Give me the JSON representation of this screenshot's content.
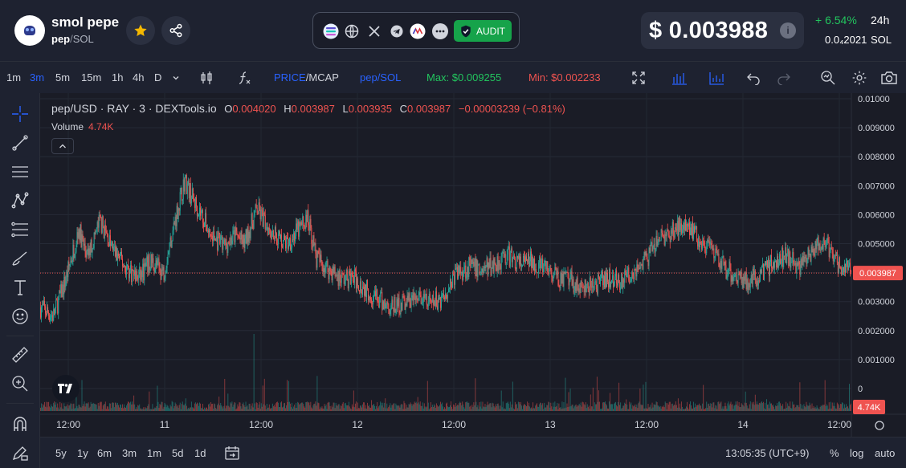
{
  "header": {
    "token_name": "smol pepe",
    "token_symbol": "pep",
    "separator": "/",
    "quote_symbol": "SOL",
    "audit_label": "AUDIT",
    "price": "$ 0.003988",
    "info_symbol": "i",
    "change": "+ 6.54%",
    "period": "24h",
    "sol_price": "0.0₄2021",
    "sol_unit": "SOL",
    "colors": {
      "positive": "#22c55e",
      "negative": "#ef5350",
      "accent": "#2962ff",
      "audit": "#16a34a"
    }
  },
  "toolbar": {
    "timeframes": [
      "1m",
      "3m",
      "5m",
      "15m",
      "1h",
      "4h",
      "D"
    ],
    "active_timeframe": "3m",
    "price_label": "PRICE",
    "slash": "/",
    "mcap_label": "MCAP",
    "pair_label": "pep/SOL",
    "max_label": "Max: $0.009255",
    "min_label": "Min: $0.002233"
  },
  "chart": {
    "pair": "pep/USD · RAY · 3 · DEXTools.io",
    "o_label": "O",
    "o_value": "0.004020",
    "h_label": "H",
    "h_value": "0.003987",
    "l_label": "L",
    "l_value": "0.003935",
    "c_label": "C",
    "c_value": "0.003987",
    "change_value": "−0.00003239 (−0.81%)",
    "volume_label": "Volume",
    "volume_value": "4.74K",
    "current_price_tag": "0.003987",
    "volume_tag": "4.74K"
  },
  "bottom": {
    "ranges": [
      "5y",
      "1y",
      "6m",
      "3m",
      "1m",
      "5d",
      "1d"
    ],
    "clock": "13:05:35 (UTC+9)",
    "percent": "%",
    "log": "log",
    "auto": "auto"
  },
  "chart_data": {
    "type": "candlestick",
    "y_ticks": [
      "0.01000",
      "0.009000",
      "0.008000",
      "0.007000",
      "0.006000",
      "0.005000",
      "0.004000",
      "0.003000",
      "0.002000",
      "0.001000",
      "0"
    ],
    "x_ticks": [
      "12:00",
      "11",
      "12:00",
      "12",
      "12:00",
      "13",
      "12:00",
      "14",
      "12:00"
    ],
    "ylim": [
      0,
      0.01
    ],
    "last_price": 0.003987,
    "close_path": [
      [
        0,
        0.0028
      ],
      [
        3,
        0.0025
      ],
      [
        6,
        0.0038
      ],
      [
        9,
        0.0055
      ],
      [
        11,
        0.0045
      ],
      [
        14,
        0.0058
      ],
      [
        17,
        0.0048
      ],
      [
        20,
        0.0042
      ],
      [
        23,
        0.0038
      ],
      [
        26,
        0.0044
      ],
      [
        29,
        0.004
      ],
      [
        32,
        0.006
      ],
      [
        34,
        0.0072
      ],
      [
        36,
        0.0065
      ],
      [
        38,
        0.006
      ],
      [
        40,
        0.0053
      ],
      [
        43,
        0.0049
      ],
      [
        46,
        0.0053
      ],
      [
        48,
        0.005
      ],
      [
        51,
        0.0062
      ],
      [
        53,
        0.0057
      ],
      [
        56,
        0.0052
      ],
      [
        58,
        0.005
      ],
      [
        61,
        0.0055
      ],
      [
        63,
        0.0059
      ],
      [
        65,
        0.0045
      ],
      [
        68,
        0.0041
      ],
      [
        71,
        0.0038
      ],
      [
        74,
        0.0038
      ],
      [
        77,
        0.0034
      ],
      [
        80,
        0.003
      ],
      [
        83,
        0.0028
      ],
      [
        86,
        0.003
      ],
      [
        89,
        0.0031
      ],
      [
        92,
        0.0029
      ],
      [
        95,
        0.0032
      ],
      [
        98,
        0.004
      ],
      [
        101,
        0.0042
      ],
      [
        104,
        0.0041
      ],
      [
        107,
        0.0043
      ],
      [
        110,
        0.0046
      ],
      [
        113,
        0.0043
      ],
      [
        116,
        0.0044
      ],
      [
        119,
        0.0041
      ],
      [
        122,
        0.0038
      ],
      [
        125,
        0.0037
      ],
      [
        128,
        0.0034
      ],
      [
        131,
        0.0036
      ],
      [
        134,
        0.0038
      ],
      [
        137,
        0.0037
      ],
      [
        140,
        0.0041
      ],
      [
        143,
        0.0045
      ],
      [
        146,
        0.0052
      ],
      [
        149,
        0.0054
      ],
      [
        152,
        0.0058
      ],
      [
        155,
        0.0052
      ],
      [
        158,
        0.0047
      ],
      [
        161,
        0.0042
      ],
      [
        164,
        0.0039
      ],
      [
        167,
        0.0037
      ],
      [
        170,
        0.004
      ],
      [
        173,
        0.0044
      ],
      [
        176,
        0.0046
      ],
      [
        179,
        0.0042
      ],
      [
        182,
        0.0048
      ],
      [
        185,
        0.005
      ],
      [
        188,
        0.0043
      ],
      [
        191,
        0.004
      ]
    ],
    "high_max": 0.009255,
    "low_min": 0.002233
  }
}
